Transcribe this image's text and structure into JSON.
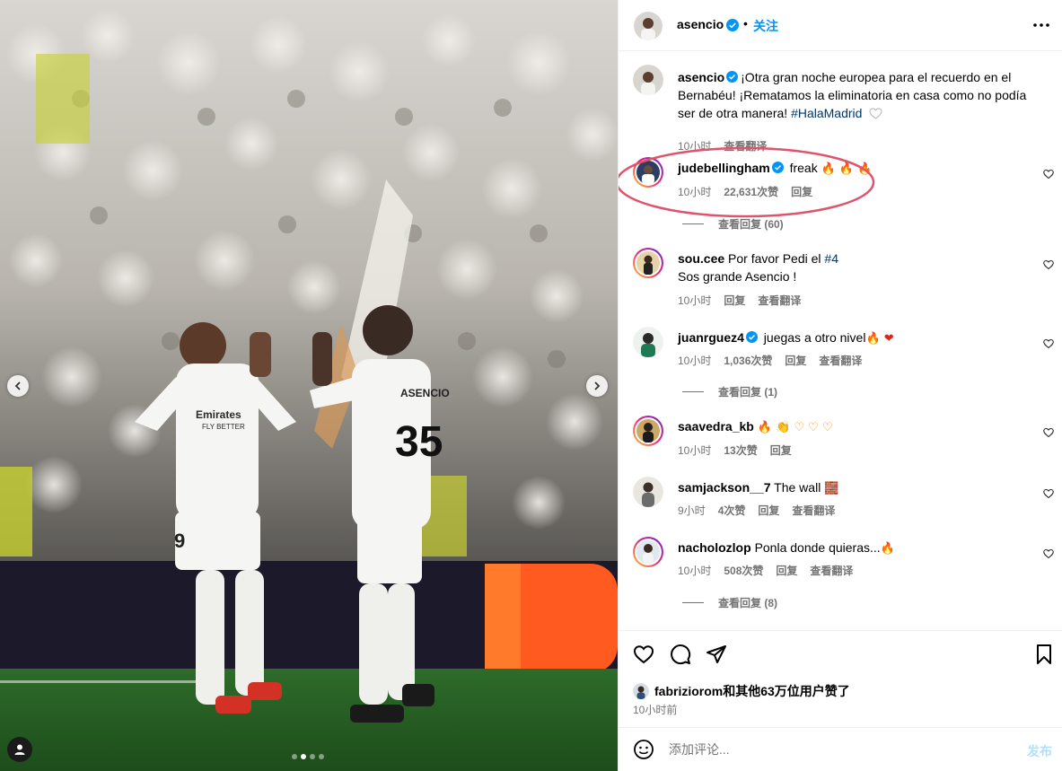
{
  "header": {
    "username": "asencio",
    "dot": "•",
    "follow_label": "关注"
  },
  "caption": {
    "username": "asencio",
    "text": "¡Otra gran noche europea para el recuerdo en el Bernabéu! ¡Rematamos la eliminatoria en casa como no podía ser de otra manera! ",
    "hashtag": "#HalaMadrid",
    "time": "10小时",
    "translate": "查看翻译"
  },
  "comments": [
    {
      "username": "judebellingham",
      "verified": true,
      "text": "freak ",
      "emoji": "🔥 🔥 🔥",
      "time": "10小时",
      "likes": "22,631次赞",
      "reply": "回复",
      "view_replies": "查看回复 (60)"
    },
    {
      "username": "sou.cee",
      "verified": false,
      "text": "Por favor Pedi el ",
      "tag": "#4",
      "text2": "Sos grande Asencio !",
      "time": "10小时",
      "reply": "回复",
      "translate": "查看翻译"
    },
    {
      "username": "juanrguez4",
      "verified": true,
      "text": "juegas a otro nivel",
      "emoji": "🔥 ❤",
      "time": "10小时",
      "likes": "1,036次赞",
      "reply": "回复",
      "translate": "查看翻译",
      "view_replies": "查看回复 (1)"
    },
    {
      "username": "saavedra_kb",
      "verified": false,
      "text": "",
      "emoji": "🔥 👏 ♡ ♡ ♡",
      "time": "10小时",
      "likes": "13次赞",
      "reply": "回复"
    },
    {
      "username": "samjackson__7",
      "verified": false,
      "text": "The wall ",
      "emoji": "🧱",
      "time": "9小时",
      "likes": "4次赞",
      "reply": "回复",
      "translate": "查看翻译"
    },
    {
      "username": "nacholozlop",
      "verified": false,
      "text": "Ponla donde quieras...",
      "emoji": "🔥",
      "time": "10小时",
      "likes": "508次赞",
      "reply": "回复",
      "translate": "查看翻译",
      "view_replies": "查看回复 (8)"
    }
  ],
  "likes_line": {
    "user": "fabriziorom",
    "suffix": "和其他63万位用户赞了"
  },
  "post_time": "10小时前",
  "add_comment": {
    "placeholder": "添加评论...",
    "post_label": "发布"
  },
  "photo": {
    "jersey_left": "Emirates FLY BETTER",
    "jersey_right": "ASENCIO",
    "number_right": "35",
    "number_left": "9"
  },
  "colors": {
    "accent": "#0095f6",
    "highlight": "#e0536c",
    "verified": "#0095f6"
  }
}
